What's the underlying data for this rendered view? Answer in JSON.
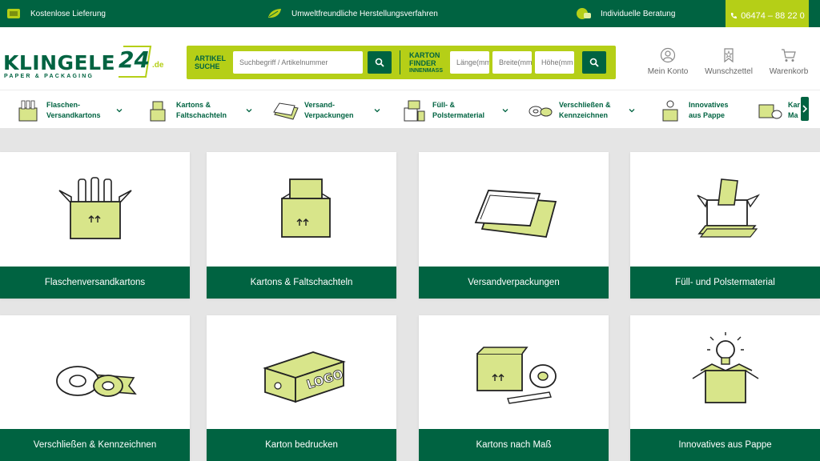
{
  "topbar": {
    "shipping": "Kostenlose Lieferung",
    "eco": "Umweltfreundliche Herstellungsverfahren",
    "advice": "Individuelle Beratung",
    "phone": "06474 – 88 22 0"
  },
  "logo": {
    "word": "KLINGELE",
    "num": "24",
    "tld": ".de",
    "tagline": "PAPER & PACKAGING"
  },
  "search": {
    "label_line1": "ARTIKEL",
    "label_line2": "SUCHE",
    "placeholder": "Suchbegriff / Artikelnummer",
    "finder_line1": "KARTON",
    "finder_line2": "FINDER",
    "finder_line3": "INNENMASS",
    "length_placeholder": "Länge(mm",
    "width_placeholder": "Breite(mm",
    "height_placeholder": "Höhe(mm"
  },
  "header_links": {
    "account": "Mein Konto",
    "wishlist": "Wunschzettel",
    "cart": "Warenkorb"
  },
  "categories": [
    {
      "line1": "Flaschen-",
      "line2": "Versandkartons"
    },
    {
      "line1": "Kartons &",
      "line2": "Faltschachteln"
    },
    {
      "line1": "Versand-",
      "line2": "Verpackungen"
    },
    {
      "line1": "Füll- &",
      "line2": "Polstermaterial"
    },
    {
      "line1": "Verschließen &",
      "line2": "Kennzeichnen"
    },
    {
      "line1": "Innovatives",
      "line2": "aus Pappe"
    },
    {
      "line1": "Kar",
      "line2": "Ma"
    }
  ],
  "tiles": [
    "Flaschenversandkartons",
    "Kartons & Faltschachteln",
    "Versandverpackungen",
    "Füll- und Polstermaterial",
    "Verschließen & Kennzeichnen",
    "Karton bedrucken",
    "Kartons nach Maß",
    "Innovatives aus Pappe"
  ],
  "tile_logo_text": "LOGO",
  "colors": {
    "brand_green": "#006341",
    "lime": "#b5cf17",
    "illustration_fill": "#d8e58a"
  }
}
